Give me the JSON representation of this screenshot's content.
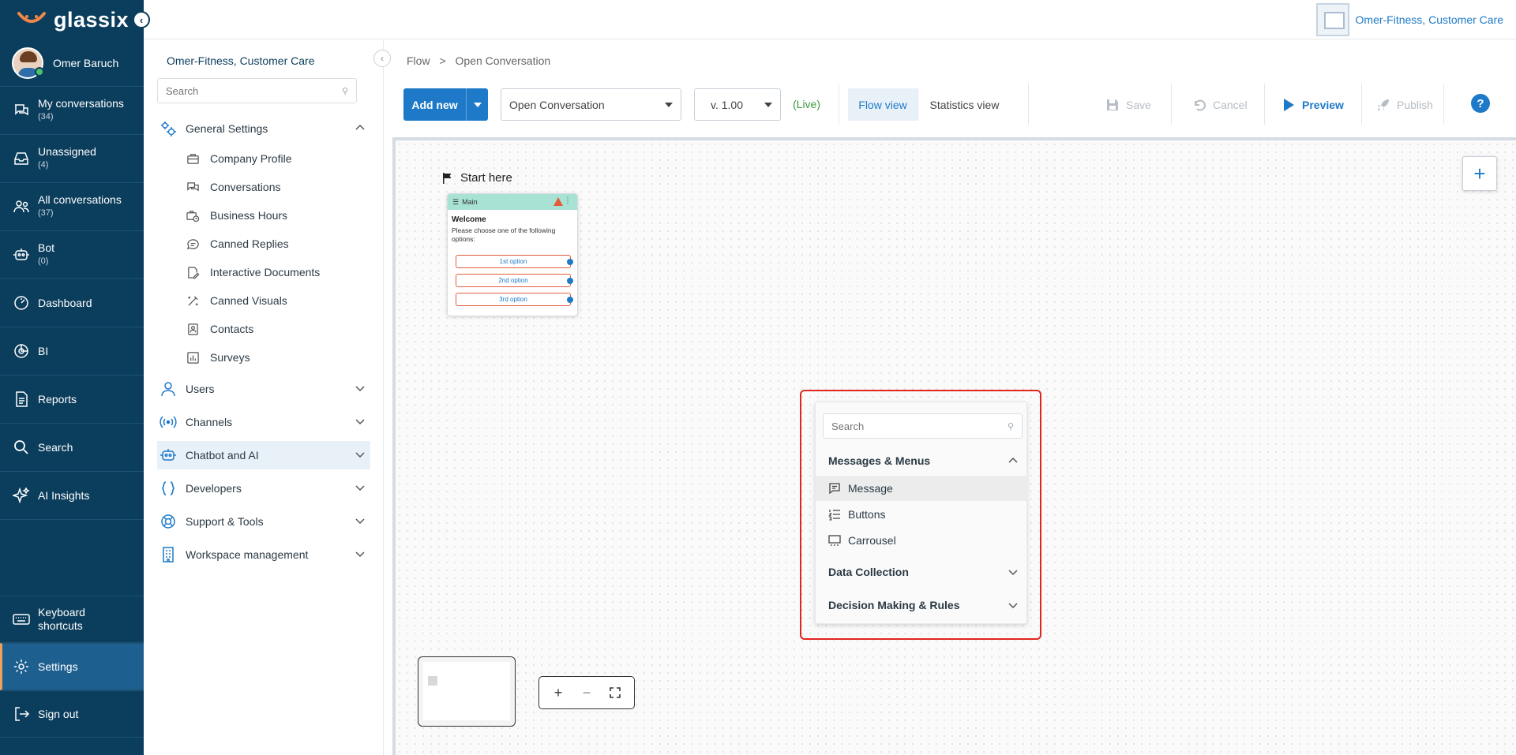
{
  "app": {
    "brand": "glassix",
    "account": "Omer-Fitness, Customer Care"
  },
  "user": {
    "name": "Omer Baruch"
  },
  "nav": {
    "items": [
      {
        "label": "My conversations",
        "count": "(34)"
      },
      {
        "label": "Unassigned",
        "count": "(4)"
      },
      {
        "label": "All conversations",
        "count": "(37)"
      },
      {
        "label": "Bot",
        "count": "(0)"
      },
      {
        "label": "Dashboard"
      },
      {
        "label": "BI"
      },
      {
        "label": "Reports"
      },
      {
        "label": "Search"
      },
      {
        "label": "AI Insights"
      }
    ],
    "bottom": [
      {
        "label": "Keyboard shortcuts"
      },
      {
        "label": "Settings"
      },
      {
        "label": "Sign out"
      }
    ]
  },
  "settings": {
    "title": "Omer-Fitness, Customer Care",
    "search_placeholder": "Search",
    "general": "General Settings",
    "sub": [
      "Company Profile",
      "Conversations",
      "Business Hours",
      "Canned Replies",
      "Interactive Documents",
      "Canned Visuals",
      "Contacts",
      "Surveys"
    ],
    "sections": [
      "Users",
      "Channels",
      "Chatbot and AI",
      "Developers",
      "Support & Tools",
      "Workspace management"
    ]
  },
  "breadcrumb": [
    "Flow",
    ">",
    "Open Conversation"
  ],
  "toolbar": {
    "add_new": "Add new",
    "flow_select": "Open Conversation",
    "version": "v. 1.00",
    "live": "(Live)",
    "flow_view": "Flow view",
    "stats_view": "Statistics view",
    "save": "Save",
    "cancel": "Cancel",
    "preview": "Preview",
    "publish": "Publish",
    "help": "?"
  },
  "canvas": {
    "start": "Start here",
    "node": {
      "header": "Main",
      "title": "Welcome",
      "text": "Please choose one of the following options:",
      "options": [
        "1st option",
        "2nd option",
        "3rd option"
      ]
    },
    "add": "+"
  },
  "popup": {
    "search_placeholder": "Search",
    "sections": [
      "Messages & Menus",
      "Data Collection",
      "Decision Making & Rules"
    ],
    "items": [
      "Message",
      "Buttons",
      "Carrousel"
    ]
  },
  "zoom": {
    "in": "+",
    "out": "−"
  }
}
